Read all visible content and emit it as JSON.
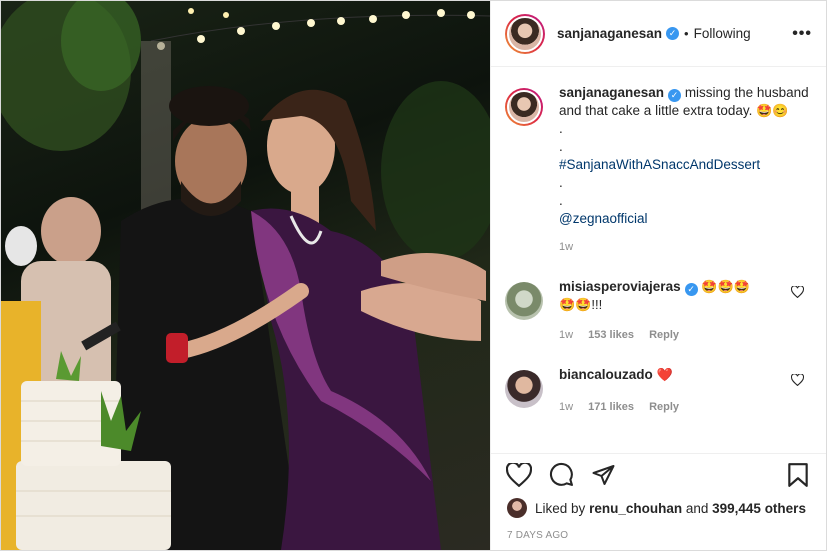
{
  "header": {
    "username": "sanjanaganesan",
    "separator": "•",
    "follow_status": "Following",
    "more_label": "•••"
  },
  "caption": {
    "username": "sanjanaganesan",
    "text": "missing the husband and that cake a little extra today.",
    "emoji": "🤩😊",
    "dot1": ".",
    "dot2": ".",
    "hashtag": "#SanjanaWithASnaccAndDessert",
    "dot3": ".",
    "dot4": ".",
    "mention": "@zegnaofficial",
    "time": "1w"
  },
  "comments": [
    {
      "username": "misiasperoviajeras",
      "text": "🤩🤩🤩",
      "text2": "🤩🤩!!!",
      "time": "1w",
      "likes": "153 likes",
      "reply": "Reply"
    },
    {
      "username": "biancalouzado",
      "text": "❤️",
      "time": "1w",
      "likes": "171 likes",
      "reply": "Reply"
    }
  ],
  "likes_bar": {
    "prefix": "Liked by",
    "user": "renu_chouhan",
    "middle": "and",
    "count": "399,445 others"
  },
  "timestamp": "7 DAYS AGO",
  "icons": {
    "verified": "verified-badge-icon",
    "like": "heart-icon",
    "comment": "comment-bubble-icon",
    "share": "paper-plane-icon",
    "save": "bookmark-icon"
  },
  "colors": {
    "verified": "#3897f0",
    "hashtag": "#00376b",
    "muted": "#8e8e8e",
    "heart": "#ed4956",
    "dress": "#7a2a78"
  }
}
